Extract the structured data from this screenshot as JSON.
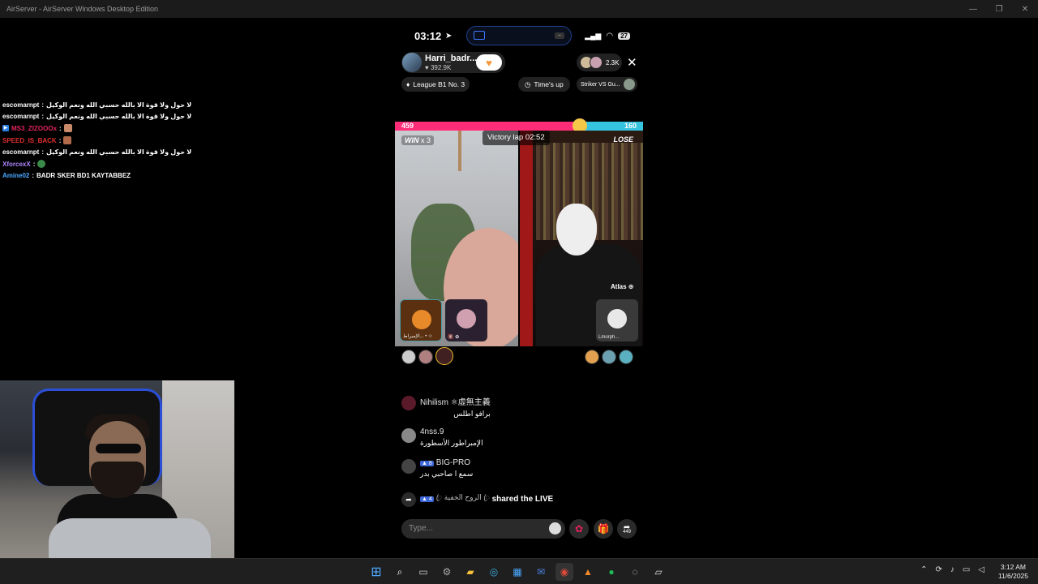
{
  "window": {
    "title": "AirServer - AirServer Windows Desktop Edition"
  },
  "stream_chat": [
    {
      "user": "escomarnpt",
      "user_color": "#ffffff",
      "message": "لا حول ولا قوة الا بالله حسبي الله ونعم الوكيل"
    },
    {
      "user": "escomarnpt",
      "user_color": "#ffffff",
      "message": "لا حول ولا قوة الا بالله حسبي الله ونعم الوكيل"
    },
    {
      "user": "MS3_ZIZOOOx",
      "user_color": "#e0245e",
      "message": ""
    },
    {
      "user": "SPEED_IS_BACK",
      "user_color": "#e03030",
      "message": ""
    },
    {
      "user": "escomarnpt",
      "user_color": "#ffffff",
      "message": "لا حول ولا قوة الا بالله حسبي الله ونعم الوكيل"
    },
    {
      "user": "XforcexX",
      "user_color": "#b085ff",
      "message": ""
    },
    {
      "user": "Amine02",
      "user_color": "#4aa8ff",
      "message": "BADR SKER BD1 KAYTABBEZ"
    }
  ],
  "phone": {
    "status_time": "03:12",
    "battery": "27",
    "host": {
      "name": "Harri_badr...",
      "likes": "392.9K"
    },
    "viewer_count": "2.3K",
    "league": "League B1 No. 3",
    "times_up": "Time's up",
    "striker": "Striker VS Gu...",
    "battle": {
      "left_score": "459",
      "right_score": "160",
      "left_fraction": 0.74,
      "win_label": "WIN",
      "win_count": "x 3",
      "lose_label": "LOSE",
      "timer_label": "Victory lap",
      "timer_value": "02:52",
      "guest_name": "Atlas",
      "tile_left_caption": "الإمبراط... • ☆",
      "tile_right_caption": "Lmorph..."
    },
    "left_ranks": [
      "3",
      "2",
      "MVP"
    ],
    "right_ranks": [
      "",
      "2",
      "3"
    ],
    "comments": [
      {
        "name": "Nihilism ⚛虛無主義",
        "level": "",
        "text": "برافو اطلس"
      },
      {
        "name": "4nss.9",
        "level": "",
        "text": "الإمبراطور الأسطورة"
      },
      {
        "name": "BIG-PRO",
        "level": "8",
        "text": "سمع ا صاحبي بدر"
      }
    ],
    "share": {
      "level": "4",
      "name": "ꦿ الروح الخفية ꦿ",
      "text": "shared the LIVE"
    },
    "input_placeholder": "Type...",
    "share_count": "449"
  },
  "taskbar": {
    "time": "3:12 AM",
    "date": "11/6/2025"
  }
}
